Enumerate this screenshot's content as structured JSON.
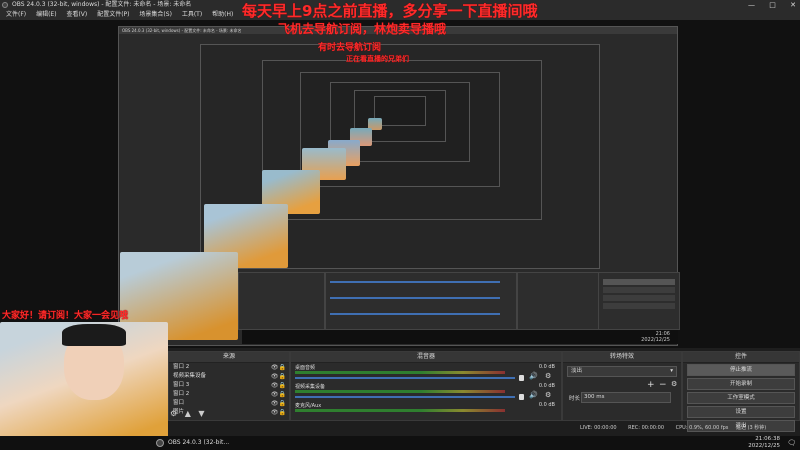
{
  "window": {
    "title": "OBS 24.0.3 (32-bit, windows) - 配置文件: 未命名 - 场景: 未命名",
    "controls": [
      "—",
      "□",
      "✕"
    ]
  },
  "menu": [
    "文件(F)",
    "编辑(E)",
    "查看(V)",
    "配置文件(P)",
    "场景集合(S)",
    "工具(T)",
    "帮助(H)"
  ],
  "overlays": {
    "line1": "每天早上9点之前直播，多分享一下直播间哦",
    "line2": "飞机去导航订阅，林炮卖导播哦",
    "line3": "有时去导航订阅",
    "line4": "正在看直播的兄弟们",
    "line5": "大家好！请订阅！大家一会见哦"
  },
  "nested": {
    "title": "OBS 24.0.3 (32-bit, windows) - 配置文件: 未命名 - 场景: 未命名",
    "clock": "21:06",
    "date": "2022/12/25"
  },
  "docks": {
    "sources_title": "来源",
    "mixer_title": "混音器",
    "transitions_title": "转场特效",
    "controls_title": "控件"
  },
  "sources": [
    {
      "name": "窗口 2"
    },
    {
      "name": "视频采集设备"
    },
    {
      "name": "窗口 3"
    },
    {
      "name": "窗口 2"
    },
    {
      "name": "窗口"
    },
    {
      "name": "图片"
    }
  ],
  "mixer": [
    {
      "name": "桌面音频",
      "db": "0.0 dB"
    },
    {
      "name": "视频采集设备",
      "db": "0.0 dB"
    },
    {
      "name": "麦克风/Aux",
      "db": "0.0 dB"
    }
  ],
  "transitions": {
    "selected": "淡出",
    "duration_label": "时长",
    "duration_value": "300 ms"
  },
  "controls": [
    "停止推流",
    "开始录制",
    "工作室模式",
    "设置",
    "退出"
  ],
  "status": {
    "live": "LIVE: 00:00:00",
    "rec": "REC: 00:00:00",
    "cpu": "CPU: 0.9%, 60.00 fps",
    "extra": "延迟 (3 秒钟)"
  },
  "taskbar": {
    "app": "OBS 24.0.3 (32-bit...",
    "time": "21:06:38",
    "date": "2022/12/25"
  }
}
